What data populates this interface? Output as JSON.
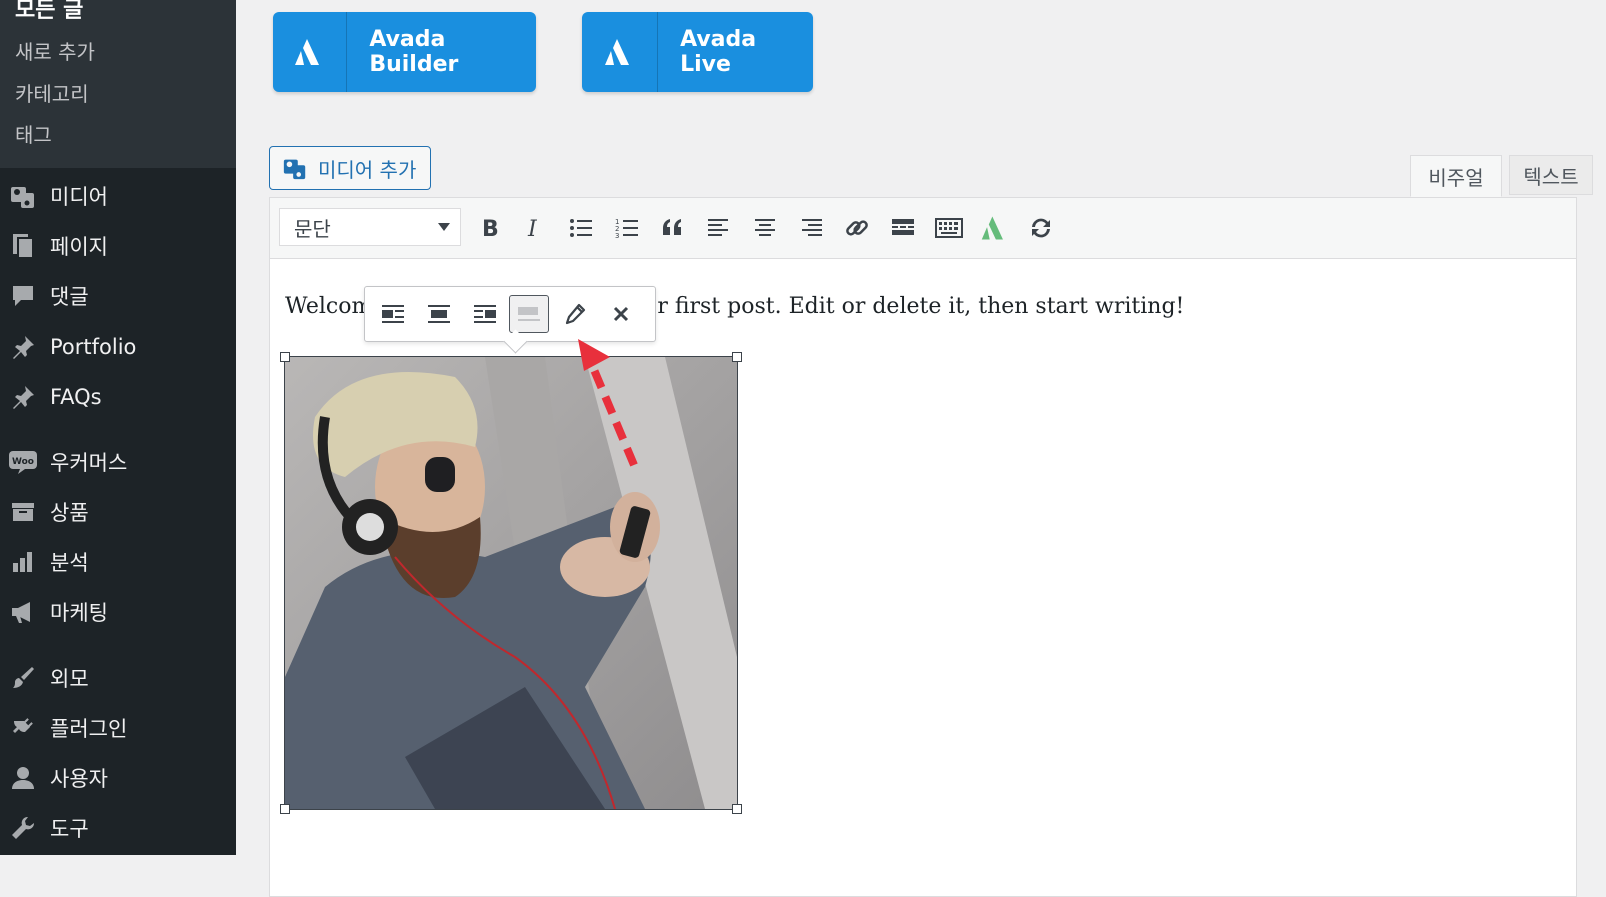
{
  "sidebar": {
    "submenu": {
      "title": "모든 글",
      "items": [
        "새로 추가",
        "카테고리",
        "태그"
      ]
    },
    "items": [
      {
        "label": "미디어",
        "icon": "media-icon"
      },
      {
        "label": "페이지",
        "icon": "pages-icon"
      },
      {
        "label": "댓글",
        "icon": "comments-icon"
      },
      {
        "label": "Portfolio",
        "icon": "pin-icon"
      },
      {
        "label": "FAQs",
        "icon": "pin-icon"
      },
      {
        "label": "우커머스",
        "icon": "woo-icon"
      },
      {
        "label": "상품",
        "icon": "archive-icon"
      },
      {
        "label": "분석",
        "icon": "chart-icon"
      },
      {
        "label": "마케팅",
        "icon": "megaphone-icon"
      },
      {
        "label": "외모",
        "icon": "brush-icon"
      },
      {
        "label": "플러그인",
        "icon": "plugin-icon"
      },
      {
        "label": "사용자",
        "icon": "user-icon"
      },
      {
        "label": "도구",
        "icon": "wrench-icon"
      }
    ],
    "woo_badge": "Woo"
  },
  "buttons": {
    "avada_builder": "Avada Builder",
    "avada_live": "Avada Live",
    "add_media": "미디어 추가"
  },
  "tabs": {
    "visual": "비주얼",
    "text": "텍스트"
  },
  "toolbar": {
    "format_value": "문단",
    "buttons": [
      "bold-icon",
      "italic-icon",
      "bullet-list-icon",
      "numbered-list-icon",
      "blockquote-icon",
      "align-left-icon",
      "align-center-icon",
      "align-right-icon",
      "link-icon",
      "read-more-icon",
      "keyboard-icon",
      "avada-icon",
      "refresh-icon"
    ]
  },
  "content": {
    "text_visible_left": "Welcom",
    "text_visible_right": "r first post. Edit or delete it, then start writing!"
  },
  "image_toolbar": {
    "buttons": [
      "align-left-icon",
      "align-center-icon",
      "align-right-icon",
      "no-align-icon",
      "edit-pencil-icon",
      "remove-icon"
    ],
    "active": "no-align-icon"
  },
  "colors": {
    "sidebar_bg": "#1d2327",
    "submenu_bg": "#2c3338",
    "avada_blue": "#1a8fdf",
    "wp_blue": "#2271b1",
    "arrow_red": "#e8303c"
  }
}
